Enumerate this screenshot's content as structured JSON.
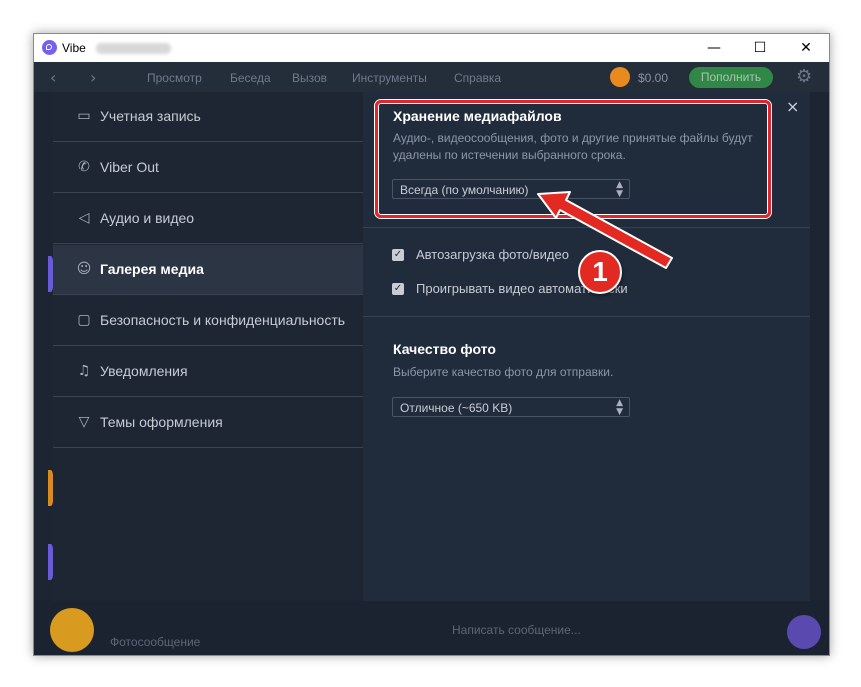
{
  "window": {
    "title": "Vibe",
    "controls": {
      "minimize": "—",
      "maximize": "☐",
      "close": "✕"
    }
  },
  "toolbar": {
    "back": "‹",
    "forward": "›",
    "menu": [
      "Просмотр",
      "Беседа",
      "Вызов",
      "Инструменты",
      "Справка"
    ],
    "balance": "$0.00",
    "topup": "Пополнить"
  },
  "background": {
    "photo_message": "Фотосообщение",
    "compose_placeholder": "Написать сообщение..."
  },
  "settings": {
    "sidebar": [
      {
        "label": "Учетная запись",
        "icon": "account-card-icon",
        "glyph": "▭"
      },
      {
        "label": "Viber Out",
        "icon": "phone-icon",
        "glyph": "✆"
      },
      {
        "label": "Аудио и видео",
        "icon": "speaker-icon",
        "glyph": "◁"
      },
      {
        "label": "Галерея медиа",
        "icon": "smiley-icon",
        "glyph": "☺"
      },
      {
        "label": "Безопасность и конфиденциальность",
        "icon": "lock-icon",
        "glyph": "▢"
      },
      {
        "label": "Уведомления",
        "icon": "bell-icon",
        "glyph": "♫"
      },
      {
        "label": "Темы оформления",
        "icon": "brush-icon",
        "glyph": "▽"
      }
    ],
    "active_index": 3,
    "media_storage": {
      "title": "Хранение медиафайлов",
      "description_line1": "Аудио-, видеосообщения, фото и другие принятые файлы будут",
      "description_line2": "удалены по истечении выбранного срока.",
      "selected": "Всегда (по умолчанию)"
    },
    "autodownload_label": "Автозагрузка фото/видео",
    "autoplay_label": "Проигрывать видео автоматически",
    "photo_quality": {
      "title": "Качество фото",
      "description": "Выберите качество фото для отправки.",
      "selected": "Отличное (~650 KB)"
    },
    "close": "×"
  },
  "annotation": {
    "badge": "1",
    "color": "#e22a23"
  }
}
